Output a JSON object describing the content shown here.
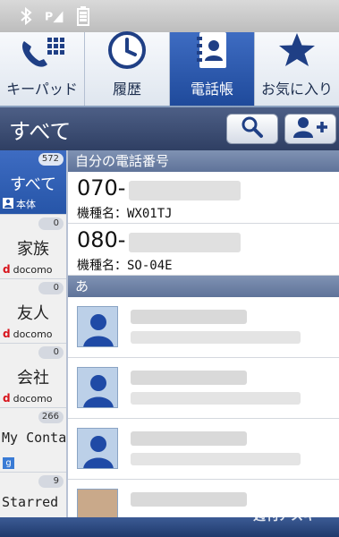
{
  "tabs": [
    {
      "label": "キーパッド",
      "icon": "phone-keypad-icon",
      "active": false
    },
    {
      "label": "履歴",
      "icon": "clock-icon",
      "active": false
    },
    {
      "label": "電話帳",
      "icon": "contacts-book-icon",
      "active": true
    },
    {
      "label": "お気に入り",
      "icon": "star-icon",
      "active": false
    }
  ],
  "title": "すべて",
  "groups": [
    {
      "count": "572",
      "name": "すべて",
      "sub": "本体"
    },
    {
      "count": "0",
      "name": "家族",
      "sub": "docomo"
    },
    {
      "count": "0",
      "name": "友人",
      "sub": "docomo"
    },
    {
      "count": "0",
      "name": "会社",
      "sub": "docomo"
    },
    {
      "count": "266",
      "name": "My Contacts",
      "sub": "g"
    },
    {
      "count": "9",
      "name": "Starred",
      "sub": ""
    }
  ],
  "my_number": {
    "header": "自分の電話番号",
    "entries": [
      {
        "prefix": "070-",
        "model": "機種名：WX01TJ"
      },
      {
        "prefix": "080-",
        "model": "機種名：SO-04E"
      }
    ]
  },
  "index_header": "あ",
  "colors": {
    "accent": "#2655a8",
    "title_bar": "#3b4d72"
  },
  "watermark": "週刊アスキー"
}
